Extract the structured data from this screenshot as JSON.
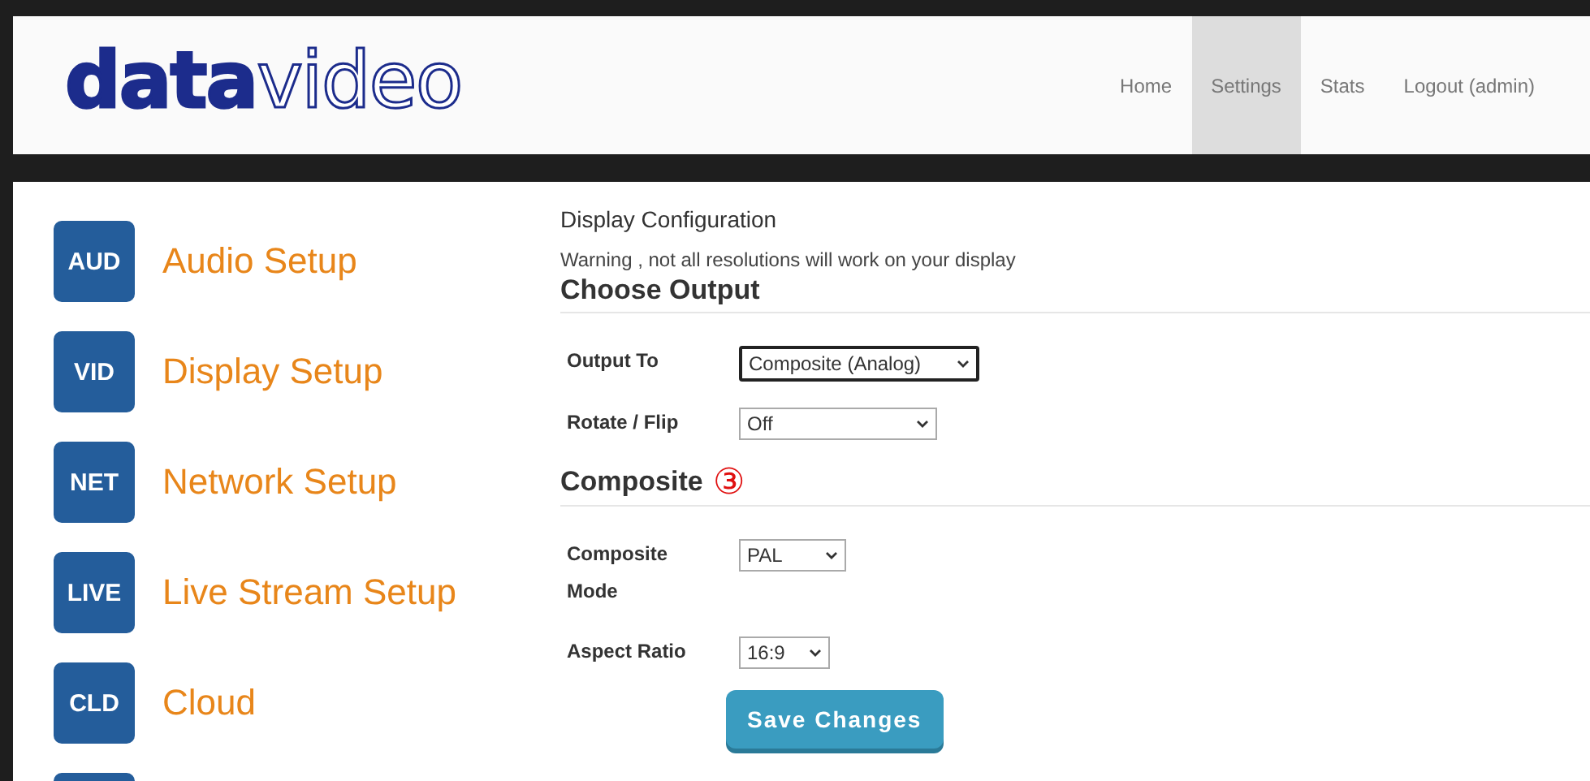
{
  "logo": "**data**video",
  "nav": [
    {
      "label": "Home",
      "selected": false
    },
    {
      "label": "Settings",
      "selected": true
    },
    {
      "label": "Stats",
      "selected": false
    },
    {
      "label": "Logout (admin)",
      "selected": false
    }
  ],
  "sidebar": {
    "items": [
      {
        "badge": "AUD",
        "label": "Audio Setup"
      },
      {
        "badge": "VID",
        "label": "Display Setup"
      },
      {
        "badge": "NET",
        "label": "Network Setup"
      },
      {
        "badge": "LIVE",
        "label": "Live Stream Setup"
      },
      {
        "badge": "CLD",
        "label": "Cloud"
      }
    ],
    "more_items_below": true
  },
  "content": {
    "title": "Display Configuration",
    "warning": "Warning , not all resolutions will work on your display",
    "sections": [
      {
        "heading": "Choose Output",
        "fields": [
          {
            "label": "Output To",
            "value": "Composite (Analog)",
            "focused": true
          },
          {
            "label": "Rotate / Flip",
            "value": "Off",
            "focused": false
          }
        ]
      },
      {
        "heading": "Composite",
        "marker": "③",
        "fields": [
          {
            "label": "Composite Mode",
            "value": "PAL",
            "focused": false
          },
          {
            "label": "Aspect Ratio",
            "value": "16:9",
            "focused": false
          }
        ]
      }
    ],
    "save_button": "Save Changes"
  }
}
